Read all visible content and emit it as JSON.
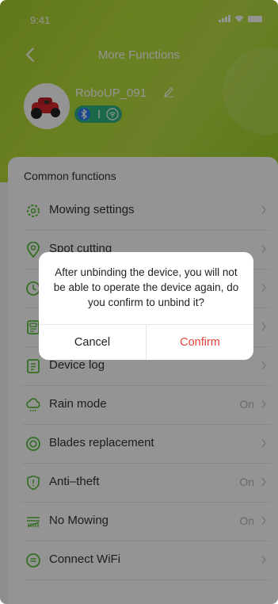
{
  "status_bar": {
    "time": "9:41"
  },
  "nav": {
    "title": "More Functions"
  },
  "device": {
    "name": "RoboUP_091"
  },
  "section": {
    "title": "Common functions"
  },
  "items": [
    {
      "label": "Mowing settings",
      "value": "",
      "icon": "gear-cluster-icon"
    },
    {
      "label": "Spot cutting",
      "value": "",
      "icon": "location-pin-icon"
    },
    {
      "label": "",
      "value": "",
      "icon": "clock-icon"
    },
    {
      "label": "",
      "value": "",
      "icon": "document-icon"
    },
    {
      "label": "Device log",
      "value": "",
      "icon": "log-icon"
    },
    {
      "label": "Rain mode",
      "value": "On",
      "icon": "cloud-rain-icon"
    },
    {
      "label": "Blades replacement",
      "value": "",
      "icon": "blade-icon"
    },
    {
      "label": "Anti–theft",
      "value": "On",
      "icon": "shield-icon"
    },
    {
      "label": "No Mowing",
      "value": "On",
      "icon": "no-mowing-icon"
    },
    {
      "label": "Connect WiFi",
      "value": "",
      "icon": "wifi-circle-icon"
    }
  ],
  "dialog": {
    "message": "After unbinding the device, you will not be able to operate the device again, do you confirm to unbind it?",
    "cancel": "Cancel",
    "confirm": "Confirm"
  },
  "colors": {
    "accent": "#b2da3b",
    "confirm": "#e0453a",
    "icon_green": "#5bbd3b"
  }
}
